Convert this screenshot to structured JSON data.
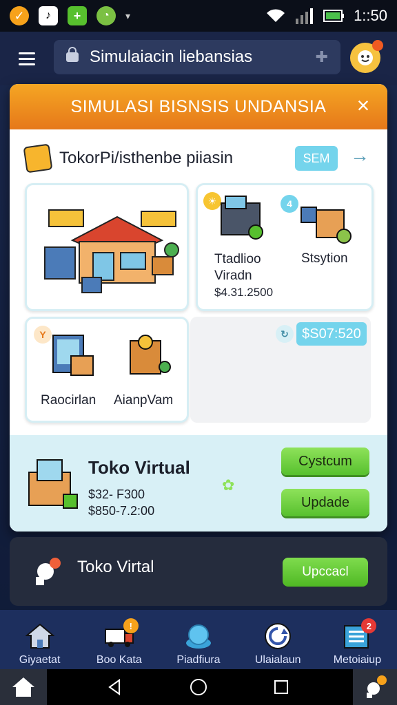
{
  "status_bar": {
    "time": "1::50",
    "left_icons": [
      "notification-app-icon",
      "music-icon",
      "plus-app-icon",
      "whatsapp-icon",
      "chevron-down-icon"
    ],
    "right_icons": [
      "wifi-icon",
      "signal-icon",
      "battery-icon"
    ]
  },
  "app_bar": {
    "url_text": "Simulaiacin liebansias",
    "menu_icon": "hamburger-icon",
    "avatar_icon": "avatar-icon"
  },
  "dialog": {
    "title": "SIMULASI BISNSIS UNDANSIA",
    "close_label": "×",
    "sub_title": "TokorPi/isthenbe piiasin",
    "sub_badge": "SEM",
    "cards": [
      {
        "id": "shop",
        "label": "",
        "price": ""
      },
      {
        "id": "card2",
        "label": "Ttadlioo\nViradn",
        "price": "$4.31.2500"
      },
      {
        "id": "card3",
        "label": "Stsytion",
        "price": ""
      },
      {
        "id": "card4",
        "label_a": "Raocirlan",
        "label_b": "AianpVam",
        "badge": "Y"
      },
      {
        "id": "card5",
        "price": "$S07:520"
      }
    ],
    "featured": {
      "title": "Toko Virtual",
      "price_1": "$32-  F300",
      "price_2": "$850-7.2:00",
      "btn_primary": "Cystcum",
      "btn_secondary": "Updade"
    }
  },
  "bottom_card": {
    "title": "Toko Virtal",
    "button": "Upccacl"
  },
  "bottom_nav": {
    "items": [
      {
        "label": "Giyaetat",
        "icon": "home-icon",
        "badge": ""
      },
      {
        "label": "Boo Kata",
        "icon": "truck-icon",
        "badge": "!"
      },
      {
        "label": "Piadfiura",
        "icon": "globe-icon",
        "badge": ""
      },
      {
        "label": "Ulaialaun",
        "icon": "refresh-icon",
        "badge": ""
      },
      {
        "label": "Metoiaiup",
        "icon": "list-icon",
        "badge": "2"
      }
    ]
  },
  "colors": {
    "accent_orange": "#e6781a",
    "accent_cyan": "#74d4ec",
    "accent_green": "#57c02e",
    "nav_bg": "#1d2f5e"
  }
}
